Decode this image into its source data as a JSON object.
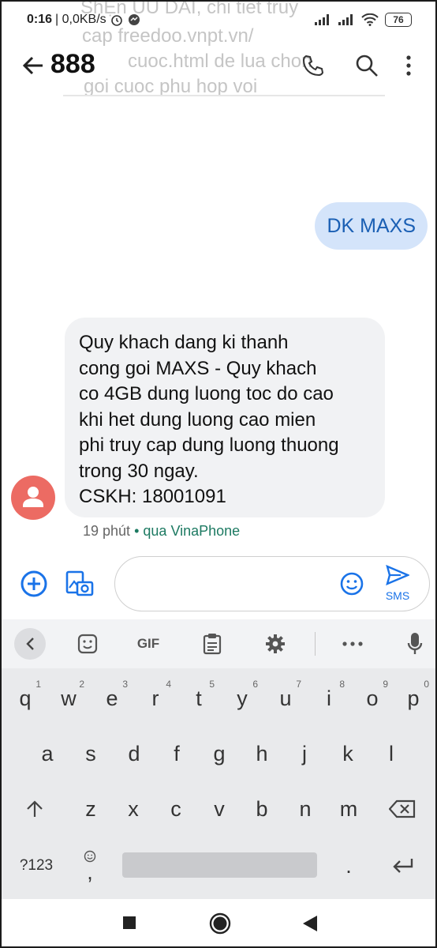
{
  "status": {
    "time": "0:16",
    "speed": "| 0,0KB/s",
    "battery": "76"
  },
  "background_text": {
    "line1": "ShẸn UU DAI, chi tiet truy",
    "line2": "cap freedoo.vnpt.vn/",
    "line3": "cuoc.html de lua chon",
    "line4": "goi cuoc phu hop voi"
  },
  "appbar": {
    "title": "888",
    "back_icon": "arrow-left-icon",
    "call_icon": "phone-icon",
    "search_icon": "search-icon",
    "more_icon": "more-vert-icon"
  },
  "messages": {
    "outgoing": {
      "text": "DK MAXS"
    },
    "incoming": {
      "lines": [
        "Quy khach dang ki thanh",
        "cong goi MAXS - Quy khach",
        "co 4GB dung luong toc do cao",
        "khi het dung luong cao mien",
        "phi truy cap dung luong thuong",
        "trong 30 ngay.",
        "CSKH: 18001091"
      ],
      "time": "19 phút",
      "separator": "•",
      "via": "qua VinaPhone"
    }
  },
  "compose": {
    "placeholder": "",
    "send_label": "SMS"
  },
  "keyboard": {
    "toolbar": {
      "gif": "GIF"
    },
    "row1": [
      {
        "k": "q",
        "h": "1"
      },
      {
        "k": "w",
        "h": "2"
      },
      {
        "k": "e",
        "h": "3"
      },
      {
        "k": "r",
        "h": "4"
      },
      {
        "k": "t",
        "h": "5"
      },
      {
        "k": "y",
        "h": "6"
      },
      {
        "k": "u",
        "h": "7"
      },
      {
        "k": "i",
        "h": "8"
      },
      {
        "k": "o",
        "h": "9"
      },
      {
        "k": "p",
        "h": "0"
      }
    ],
    "row2": [
      "a",
      "s",
      "d",
      "f",
      "g",
      "h",
      "j",
      "k",
      "l"
    ],
    "row3": [
      "z",
      "x",
      "c",
      "v",
      "b",
      "n",
      "m"
    ],
    "symbols": "?123",
    "comma": ",",
    "period": "."
  },
  "colors": {
    "accent": "#1a73e8",
    "outgoing_bubble": "#d4e4fa",
    "incoming_bubble": "#f1f2f4",
    "avatar": "#ec6b63",
    "via": "#1d7a62"
  }
}
